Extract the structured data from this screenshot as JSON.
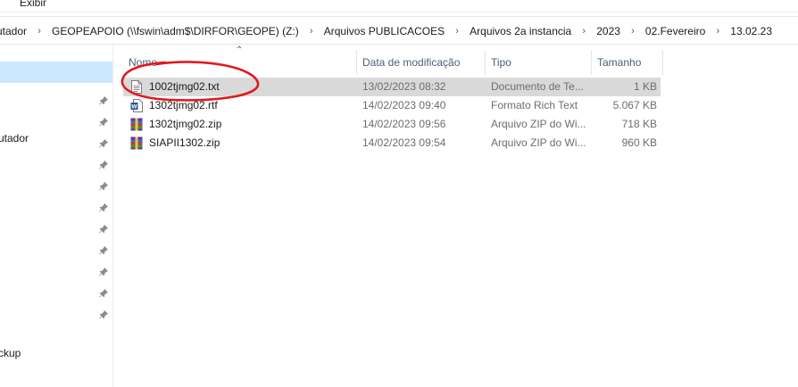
{
  "ribbon": {
    "tab_label": "Exibir"
  },
  "breadcrumb": [
    "utador",
    "GEOPEAPOIO (\\\\fswin\\adm$\\DIRFOR\\GEOPE) (Z:)",
    "Arquivos PUBLICACOES",
    "Arquivos 2a instancia",
    "2023",
    "02.Fevereiro",
    "13.02.23"
  ],
  "nav": {
    "items": [
      "utador",
      "ckup"
    ],
    "pins": 11
  },
  "columns": {
    "name": "Nome",
    "date": "Data de modificação",
    "type": "Tipo",
    "size": "Tamanho"
  },
  "files": [
    {
      "name": "1002tjmg02.txt",
      "date": "13/02/2023 08:32",
      "type": "Documento de Te...",
      "size": "1 KB",
      "icon": "text-file-icon",
      "selected": true
    },
    {
      "name": "1302tjmg02.rtf",
      "date": "14/02/2023 09:40",
      "type": "Formato Rich Text",
      "size": "5.067 KB",
      "icon": "word-rtf-icon",
      "selected": false
    },
    {
      "name": "1302tjmg02.zip",
      "date": "14/02/2023 09:56",
      "type": "Arquivo ZIP do Wi...",
      "size": "718 KB",
      "icon": "winrar-zip-icon",
      "selected": false
    },
    {
      "name": "SIAPII1302.zip",
      "date": "14/02/2023 09:54",
      "type": "Arquivo ZIP do Wi...",
      "size": "960 KB",
      "icon": "winrar-zip-icon",
      "selected": false
    }
  ],
  "annotation_color": "#e0191f",
  "selection_color": "#d9d9d9"
}
